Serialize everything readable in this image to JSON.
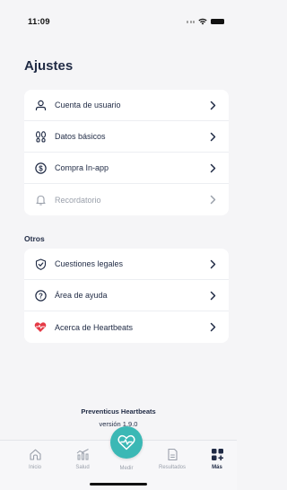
{
  "status_bar": {
    "time": "11:09"
  },
  "page": {
    "title": "Ajustes"
  },
  "settings_items": [
    {
      "label": "Cuenta de usuario",
      "icon": "user-icon",
      "enabled": true
    },
    {
      "label": "Datos básicos",
      "icon": "footprints-icon",
      "enabled": true
    },
    {
      "label": "Compra In-app",
      "icon": "dollar-circle-icon",
      "enabled": true
    },
    {
      "label": "Recordatorio",
      "icon": "bell-icon",
      "enabled": false
    }
  ],
  "others": {
    "title": "Otros",
    "items": [
      {
        "label": "Cuestiones legales",
        "icon": "shield-check-icon"
      },
      {
        "label": "Área de ayuda",
        "icon": "question-circle-icon"
      },
      {
        "label": "Acerca de Heartbeats",
        "icon": "heart-logo-icon"
      }
    ]
  },
  "footer": {
    "app_name": "Preventicus Heartbeats",
    "version": "versión 1.9.0"
  },
  "tab_bar": {
    "tabs": [
      {
        "label": "Inicio",
        "icon": "home-icon",
        "active": false
      },
      {
        "label": "Salud",
        "icon": "health-icon",
        "active": false
      },
      {
        "label": "Medir",
        "icon": "heart-pulse-icon",
        "active": false
      },
      {
        "label": "Resultados",
        "icon": "document-icon",
        "active": false
      },
      {
        "label": "Más",
        "icon": "grid-plus-icon",
        "active": true
      }
    ]
  },
  "colors": {
    "accent": "#3bb8b5",
    "text": "#1f2a44",
    "disabled": "#9aa0ab",
    "heart": "#e53945"
  }
}
